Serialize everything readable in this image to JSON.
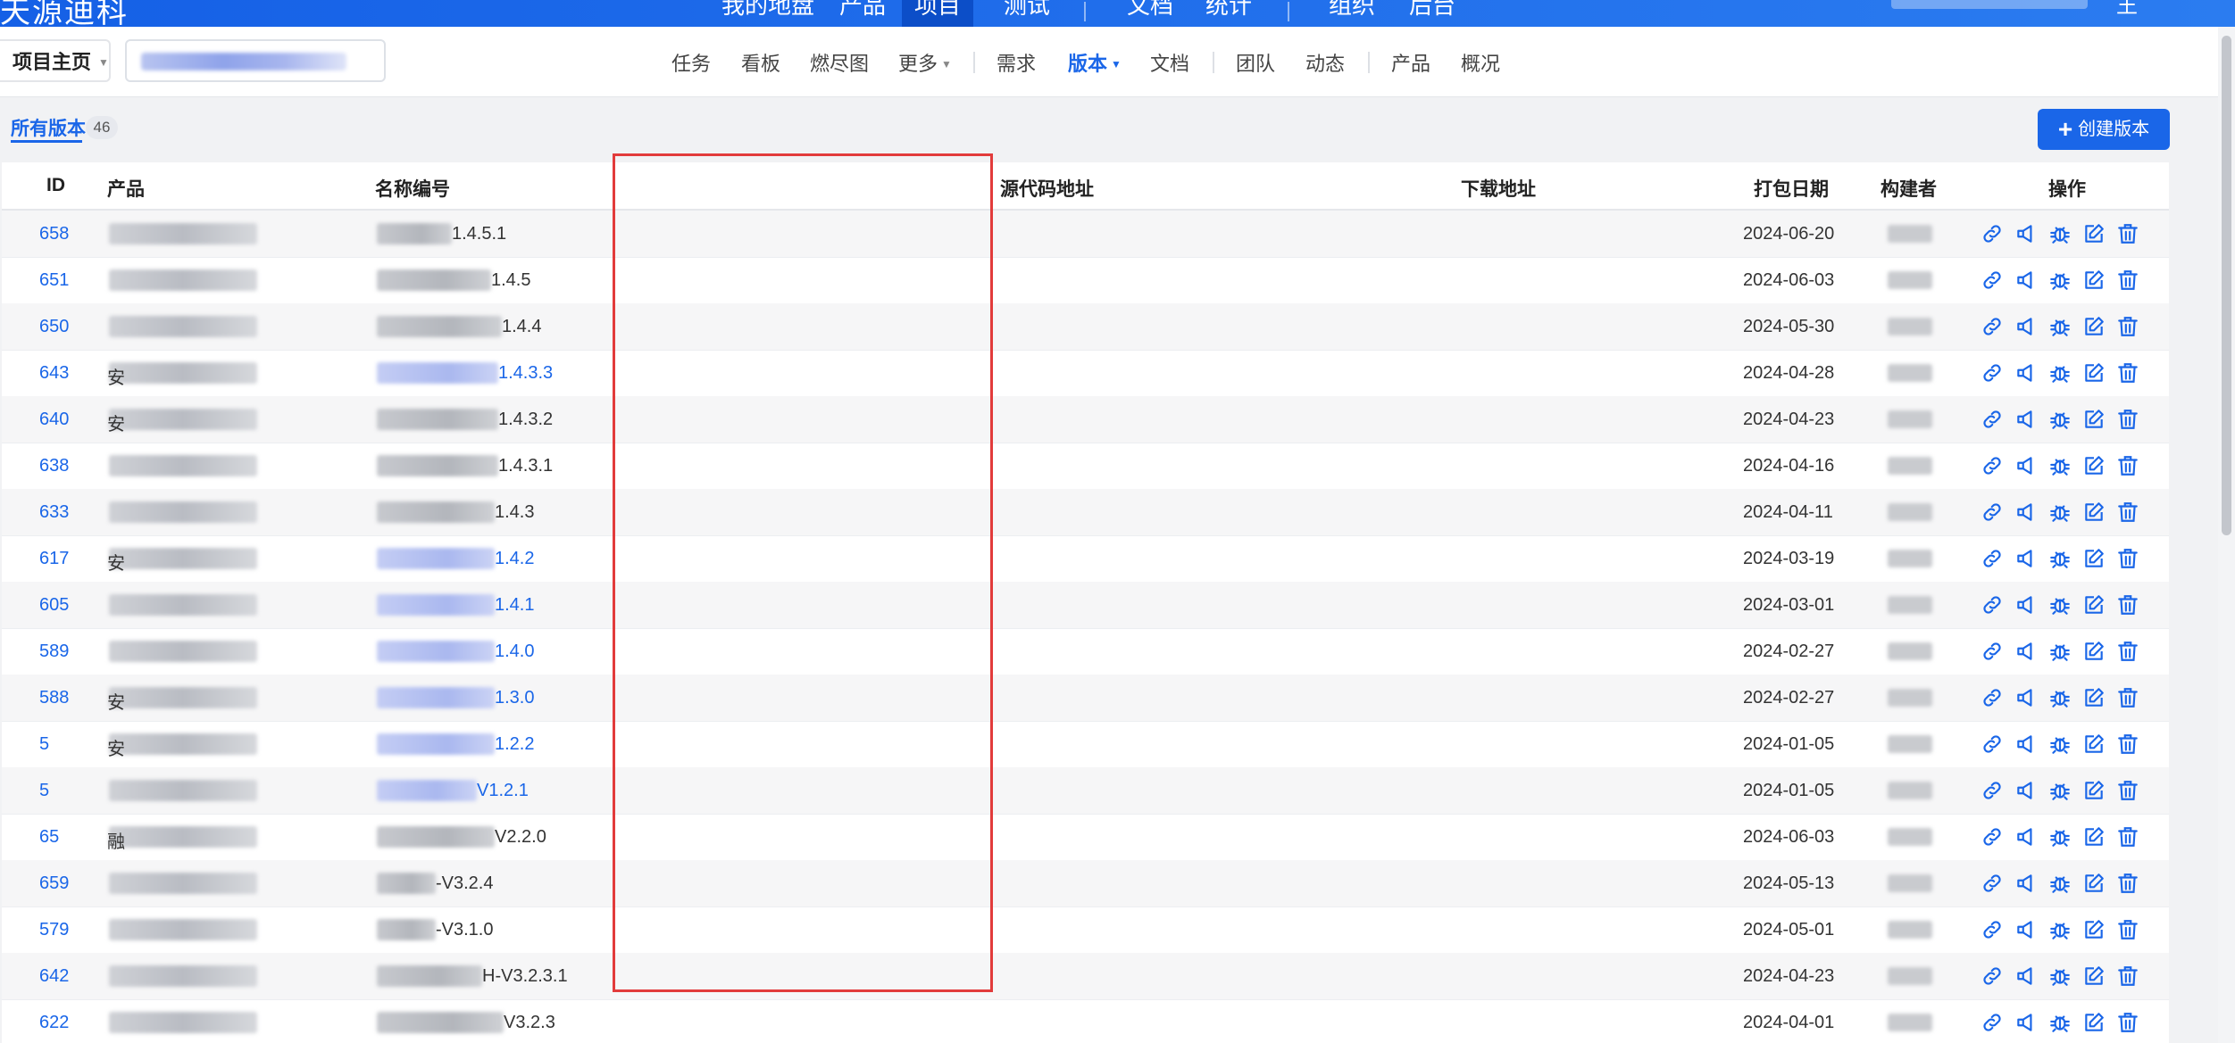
{
  "topbar": {
    "brand": "天源迪科",
    "nav": [
      "我的地盘",
      "产品",
      "项目",
      "测试",
      "文档",
      "统计",
      "组织",
      "后台"
    ],
    "active_nav": "项目",
    "user": "王"
  },
  "subnav": {
    "project_home": "项目主页",
    "tabs": [
      "任务",
      "看板",
      "燃尽图",
      "更多",
      "需求",
      "版本",
      "文档",
      "团队",
      "动态",
      "产品",
      "概况"
    ],
    "active_tab": "版本"
  },
  "filter": {
    "tab_label": "所有版本",
    "count": "46"
  },
  "create_button_label": "创建版本",
  "table": {
    "headers": {
      "id": "ID",
      "product": "产品",
      "name": "名称编号",
      "source": "源代码地址",
      "download": "下载地址",
      "date": "打包日期",
      "builder": "构建者",
      "actions": "操作"
    },
    "rows": [
      {
        "id": "658",
        "prod": "",
        "name_suffix": "1.4.5.1",
        "name_visible": "D        -A     1.4.5.1",
        "date": "2024-06-20",
        "link": false
      },
      {
        "id": "651",
        "prod": "",
        "name_suffix": "1.4.5",
        "name_visible": "   C-D          1.4.5",
        "date": "2024-06-03",
        "link": false
      },
      {
        "id": "650",
        "prod": "",
        "name_suffix": "1.4.4",
        "name_visible": "    -D          1.4.4",
        "date": "2024-05-30",
        "link": false
      },
      {
        "id": "643",
        "prod": "安",
        "name_suffix": "1.4.3.3",
        "name_visible": "    -D         1.4.3.3",
        "date": "2024-04-28",
        "link": true
      },
      {
        "id": "640",
        "prod": "安",
        "name_suffix": "1.4.3.2",
        "name_visible": "L   -D         1.4.3.2",
        "date": "2024-04-23",
        "link": false
      },
      {
        "id": "638",
        "prod": "",
        "name_suffix": "1.4.3.1",
        "name_visible": "D   D          1.4.3.1",
        "date": "2024-04-16",
        "link": false
      },
      {
        "id": "633",
        "prod": "",
        "name_suffix": "1.4.3",
        "name_visible": "D              1.4.3",
        "date": "2024-04-11",
        "link": false
      },
      {
        "id": "617",
        "prod": "安",
        "name_suffix": "1.4.2",
        "name_visible": "D              1.4.2",
        "date": "2024-03-19",
        "link": true
      },
      {
        "id": "605",
        "prod": "",
        "name_suffix": "1.4.1",
        "name_visible": "D              1.4.1",
        "date": "2024-03-01",
        "link": true
      },
      {
        "id": "589",
        "prod": "",
        "name_suffix": "1.4.0",
        "name_visible": "D              1.4.0",
        "date": "2024-02-27",
        "link": true
      },
      {
        "id": "588",
        "prod": "安",
        "name_suffix": "1.3.0",
        "name_visible": "D              1.3.0",
        "date": "2024-02-27",
        "link": true
      },
      {
        "id": "5",
        "prod": "安",
        "name_suffix": "1.2.2",
        "name_visible": "D              1.2.2",
        "date": "2024-01-05",
        "link": true
      },
      {
        "id": "5",
        "prod": "",
        "name_suffix": "V1.2.1",
        "name_visible": "D       -A     V1.2.1",
        "date": "2024-01-05",
        "link": true
      },
      {
        "id": "65",
        "prod": "融",
        "name_suffix": "V2.2.0",
        "name_visible": "I              V2.2.0",
        "date": "2024-06-03",
        "link": false
      },
      {
        "id": "659",
        "prod": "",
        "name_suffix": "-V3.2.4",
        "name_visible": "          ES    -V3.2.4",
        "date": "2024-05-13",
        "link": false
      },
      {
        "id": "579",
        "prod": "",
        "name_suffix": "-V3.1.0",
        "name_visible": "L         ES    -V3.1.0",
        "date": "2024-05-01",
        "link": false
      },
      {
        "id": "642",
        "prod": "",
        "name_suffix": "H-V3.2.3.1",
        "name_visible": "               H-V3.2.3.1",
        "date": "2024-04-23",
        "link": false
      },
      {
        "id": "622",
        "prod": "",
        "name_suffix": "V3.2.3",
        "name_visible": "               V3.2.3",
        "date": "2024-04-01",
        "link": false
      }
    ]
  },
  "icons": [
    "link-icon",
    "publish-icon",
    "bug-icon",
    "edit-icon",
    "delete-icon"
  ],
  "colors": {
    "primary": "#1a66e8",
    "annotation": "#e23b3b"
  }
}
